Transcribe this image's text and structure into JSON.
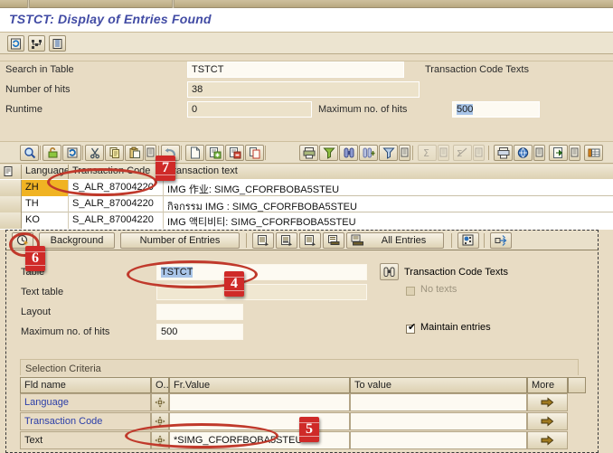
{
  "window": {
    "title": "TSTCT: Display of Entries Found"
  },
  "app_toolbar": [
    {
      "name": "refresh-icon",
      "label": "Refresh"
    },
    {
      "name": "settings-icon",
      "label": "Settings"
    },
    {
      "name": "layout-icon",
      "label": "Layout"
    }
  ],
  "header": {
    "rows": [
      {
        "label": "Search in Table",
        "value": "TSTCT",
        "extra": "Transaction Code Texts"
      },
      {
        "label": "Number of hits",
        "value": "38",
        "extra": ""
      },
      {
        "label": "Runtime",
        "value": "0",
        "extra": "Maximum no. of hits",
        "extra_value": "500"
      }
    ]
  },
  "main_toolbar": {
    "icons": [
      {
        "name": "details-icon"
      },
      {
        "name": "display-change-icon"
      },
      {
        "name": "refresh-icon"
      },
      {
        "name": "cut-icon"
      },
      {
        "name": "copy-icon"
      },
      {
        "name": "paste-icon"
      },
      {
        "name": "paste-menu-icon"
      },
      {
        "name": "undo-icon"
      },
      {
        "name": "new-entry-icon"
      },
      {
        "name": "insert-row-icon"
      },
      {
        "name": "delete-row-icon"
      },
      {
        "name": "duplicate-icon"
      },
      {
        "name": "print-icon"
      },
      {
        "name": "filter-icon"
      },
      {
        "name": "find-icon"
      },
      {
        "name": "find-next-icon"
      },
      {
        "name": "set-filter-icon"
      },
      {
        "name": "filter-menu-icon"
      },
      {
        "name": "total-icon"
      },
      {
        "name": "total-menu-icon"
      },
      {
        "name": "subtotal-icon"
      },
      {
        "name": "subtotal-menu-icon"
      },
      {
        "name": "print-preview-icon"
      },
      {
        "name": "view-icon"
      },
      {
        "name": "view-menu-icon"
      },
      {
        "name": "export-icon"
      },
      {
        "name": "export-menu-icon"
      },
      {
        "name": "grid-icon"
      }
    ]
  },
  "grid": {
    "columns": [
      "Language",
      "Transaction Code",
      "Transaction text"
    ],
    "rows": [
      {
        "language": "ZH",
        "code": "S_ALR_87004220",
        "text": "IMG 作业: SIMG_CFORFBOBA5STEU",
        "highlight": true
      },
      {
        "language": "TH",
        "code": "S_ALR_87004220",
        "text": "กิจกรรม IMG : SIMG_CFORFBOBA5STEU",
        "highlight": false
      },
      {
        "language": "KO",
        "code": "S_ALR_87004220",
        "text": "IMG 액티비티: SIMG_CFORFBOBA5STEU",
        "highlight": false
      }
    ]
  },
  "dialog": {
    "toolbar": {
      "execute_icon": "execute-clock-icon",
      "background_label": "Background",
      "number_of_entries_label": "Number of Entries",
      "entry_icons": [
        {
          "name": "first-entry-icon"
        },
        {
          "name": "previous-entry-icon"
        },
        {
          "name": "next-entry-icon"
        },
        {
          "name": "last-entry-icon"
        }
      ],
      "all_entries_icon": "all-entries-icon",
      "all_entries_label": "All Entries",
      "table_settings_icon": "table-settings-icon",
      "expand_icon": "expand-arrows-icon"
    },
    "fields": [
      {
        "label": "Table",
        "value": "TSTCT",
        "selected": true
      },
      {
        "label": "Text table",
        "value": "",
        "selected": false
      },
      {
        "label": "Layout",
        "value": "",
        "selected": false
      },
      {
        "label": "Maximum no. of hits",
        "value": "500",
        "selected": false
      }
    ],
    "right": {
      "table_texts_icon": "binoculars-icon",
      "table_texts_label": "Transaction Code Texts",
      "no_texts_label": "No texts",
      "no_texts_checked": false,
      "no_texts_disabled": true,
      "maintain_entries_label": "Maintain entries",
      "maintain_entries_checked": true
    },
    "selection_criteria": {
      "title": "Selection Criteria",
      "columns": [
        "Fld name",
        "O...",
        "Fr.Value",
        "To value",
        "More"
      ],
      "rows": [
        {
          "field": "Language",
          "op_icon": "multiple-selection-icon",
          "from": "",
          "to": "",
          "more_icon": "arrow-right-icon"
        },
        {
          "field": "Transaction Code",
          "op_icon": "multiple-selection-icon",
          "from": "",
          "to": "",
          "more_icon": "arrow-right-icon"
        },
        {
          "field": "Text",
          "op_icon": "multiple-selection-icon",
          "from": "*SIMG_CFORFBOBA5STEU*",
          "to": "",
          "more_icon": "arrow-right-icon"
        }
      ]
    }
  },
  "annotations": {
    "markers": [
      {
        "number": "7"
      },
      {
        "number": "6"
      },
      {
        "number": "4"
      },
      {
        "number": "5"
      }
    ],
    "accent_color": "#cf2a28"
  }
}
